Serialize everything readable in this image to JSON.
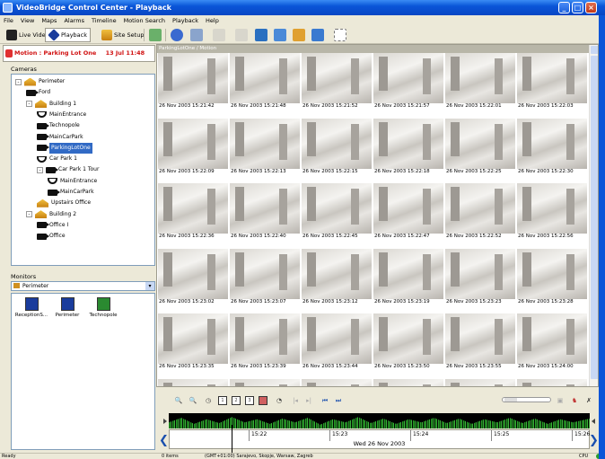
{
  "window": {
    "title": "VideoBridge Control Center - Playback"
  },
  "menu": [
    "File",
    "View",
    "Maps",
    "Alarms",
    "Timeline",
    "Motion Search",
    "Playback",
    "Help"
  ],
  "toolbar": {
    "live_video": "Live Video",
    "playback": "Playback",
    "site_setup": "Site Setup"
  },
  "motion": {
    "label": "Motion : Parking Lot One",
    "time": "13 Jul 11:48"
  },
  "cameras": {
    "header": "Cameras",
    "tree": [
      {
        "label": "Perimeter",
        "icon": "site-icon",
        "expander": "-"
      },
      {
        "label": "Ford",
        "icon": "camera-icon"
      },
      {
        "label": "Building 1",
        "icon": "site-icon",
        "expander": "-"
      },
      {
        "label": "MainEntrance",
        "icon": "dome-camera-icon"
      },
      {
        "label": "Technopole",
        "icon": "camera-icon"
      },
      {
        "label": "MainCarPark",
        "icon": "camera-icon"
      },
      {
        "label": "ParkingLotOne",
        "icon": "camera-icon",
        "selected": true
      },
      {
        "label": "Car Park 1",
        "icon": "dome-camera-icon"
      },
      {
        "label": "Car Park 1 Tour",
        "icon": "camera-group-icon",
        "expander": "-"
      },
      {
        "label": "MainEntrance",
        "icon": "dome-camera-icon"
      },
      {
        "label": "MainCarPark",
        "icon": "camera-icon"
      },
      {
        "label": "Upstairs Office",
        "icon": "site-icon"
      },
      {
        "label": "Building 2",
        "icon": "site-icon",
        "expander": "-"
      },
      {
        "label": "Office I",
        "icon": "camera-icon"
      },
      {
        "label": "Office",
        "icon": "camera-icon"
      }
    ]
  },
  "monitors": {
    "header": "Monitors",
    "selected": "Perimeter",
    "items": [
      "ReceptionS...",
      "Perimeter",
      "Technopole"
    ]
  },
  "grid": {
    "title": "ParkingLotOne / Motion",
    "timestamps": [
      "26 Nov 2003 15:21:42",
      "26 Nov 2003 15:21:48",
      "26 Nov 2003 15:21:52",
      "26 Nov 2003 15:21:57",
      "26 Nov 2003 15:22:01",
      "26 Nov 2003 15:22:03",
      "26 Nov 2003 15:22:09",
      "26 Nov 2003 15:22:13",
      "26 Nov 2003 15:22:15",
      "26 Nov 2003 15:22:18",
      "26 Nov 2003 15:22:25",
      "26 Nov 2003 15:22:30",
      "26 Nov 2003 15:22:36",
      "26 Nov 2003 15:22:40",
      "26 Nov 2003 15:22:45",
      "26 Nov 2003 15:22:47",
      "26 Nov 2003 15:22:52",
      "26 Nov 2003 15:22:56",
      "26 Nov 2003 15:23:02",
      "26 Nov 2003 15:23:07",
      "26 Nov 2003 15:23:12",
      "26 Nov 2003 15:23:19",
      "26 Nov 2003 15:23:23",
      "26 Nov 2003 15:23:28",
      "26 Nov 2003 15:23:35",
      "26 Nov 2003 15:23:39",
      "26 Nov 2003 15:23:44",
      "26 Nov 2003 15:23:50",
      "26 Nov 2003 15:23:55",
      "26 Nov 2003 15:24:00"
    ]
  },
  "playback_controls": {
    "btn_1": "1",
    "btn_2": "2",
    "btn_3": "3"
  },
  "timeline": {
    "ticks": [
      "15:22",
      "15:23",
      "15:24",
      "15:25",
      "15:26"
    ],
    "date": "Wed 26 Nov 2003"
  },
  "status": {
    "left": "Ready",
    "items": "0 items",
    "timezone": "(GMT+01:00) Sarajevo, Skopje, Warsaw, Zagreb",
    "cpu": "CPU"
  }
}
